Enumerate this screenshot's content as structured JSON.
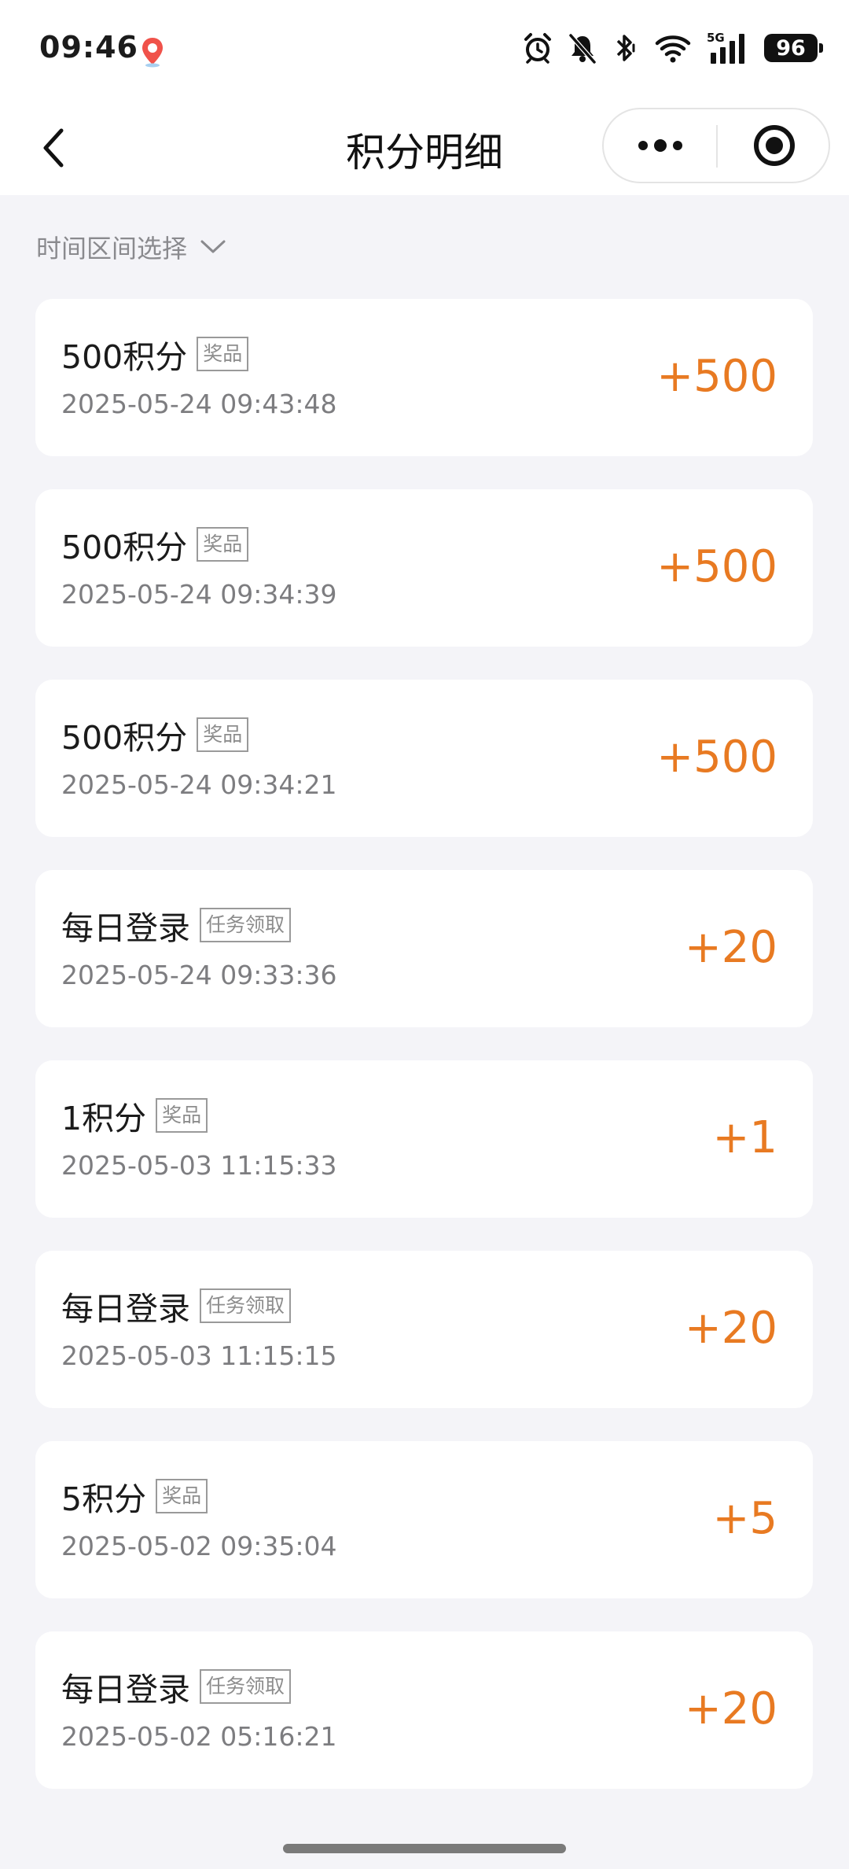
{
  "status_bar": {
    "time": "09:46",
    "network": "5G",
    "battery": "96"
  },
  "nav": {
    "title": "积分明细"
  },
  "filter": {
    "label": "时间区间选择"
  },
  "colors": {
    "points": "#e87a22",
    "background": "#f4f4f8"
  },
  "records": [
    {
      "title": "500积分",
      "tag": "奖品",
      "time": "2025-05-24 09:43:48",
      "points": "+500"
    },
    {
      "title": "500积分",
      "tag": "奖品",
      "time": "2025-05-24 09:34:39",
      "points": "+500"
    },
    {
      "title": "500积分",
      "tag": "奖品",
      "time": "2025-05-24 09:34:21",
      "points": "+500"
    },
    {
      "title": "每日登录",
      "tag": "任务领取",
      "time": "2025-05-24 09:33:36",
      "points": "+20"
    },
    {
      "title": "1积分",
      "tag": "奖品",
      "time": "2025-05-03 11:15:33",
      "points": "+1"
    },
    {
      "title": "每日登录",
      "tag": "任务领取",
      "time": "2025-05-03 11:15:15",
      "points": "+20"
    },
    {
      "title": "5积分",
      "tag": "奖品",
      "time": "2025-05-02 09:35:04",
      "points": "+5"
    },
    {
      "title": "每日登录",
      "tag": "任务领取",
      "time": "2025-05-02 05:16:21",
      "points": "+20"
    }
  ]
}
